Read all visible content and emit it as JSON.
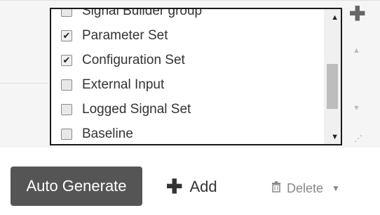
{
  "list": {
    "items": [
      {
        "label": "Signal Builder group",
        "checked": false,
        "partial": true
      },
      {
        "label": "Parameter Set",
        "checked": true
      },
      {
        "label": "Configuration Set",
        "checked": true
      },
      {
        "label": "External Input",
        "checked": false
      },
      {
        "label": "Logged Signal Set",
        "checked": false
      },
      {
        "label": "Baseline",
        "checked": false
      }
    ]
  },
  "toolbar": {
    "auto_generate_label": "Auto Generate",
    "add_label": "Add",
    "delete_label": "Delete"
  },
  "icons": {
    "check": "✔",
    "plus": "✚",
    "scroll_up": "▲",
    "scroll_down": "▼",
    "caret": "▼",
    "grip": "⋰"
  },
  "colors": {
    "primary_button_bg": "#555555",
    "primary_button_text": "#ffffff",
    "delete_text": "#888888"
  }
}
